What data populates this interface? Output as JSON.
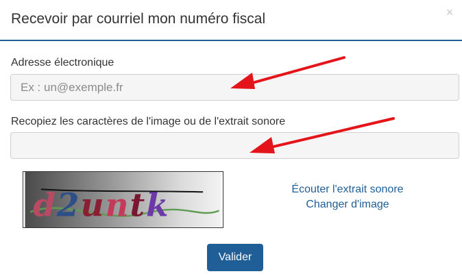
{
  "dialog": {
    "title": "Recevoir par courriel mon numéro fiscal",
    "close_symbol": "×"
  },
  "form": {
    "email_label": "Adresse électronique",
    "email_placeholder": "Ex : un@exemple.fr",
    "email_value": "",
    "captcha_label": "Recopiez les caractères de l'image ou de l'extrait sonore",
    "captcha_value": "",
    "captcha_image_text": "d2untk",
    "listen_link": "Écouter l'extrait sonore",
    "change_image_link": "Changer d'image",
    "submit_label": "Valider"
  },
  "colors": {
    "accent": "#1f5e96",
    "annotation_arrow": "#e3151a"
  },
  "icons": {
    "close": "close-icon",
    "annotation": "arrow-annotation"
  }
}
